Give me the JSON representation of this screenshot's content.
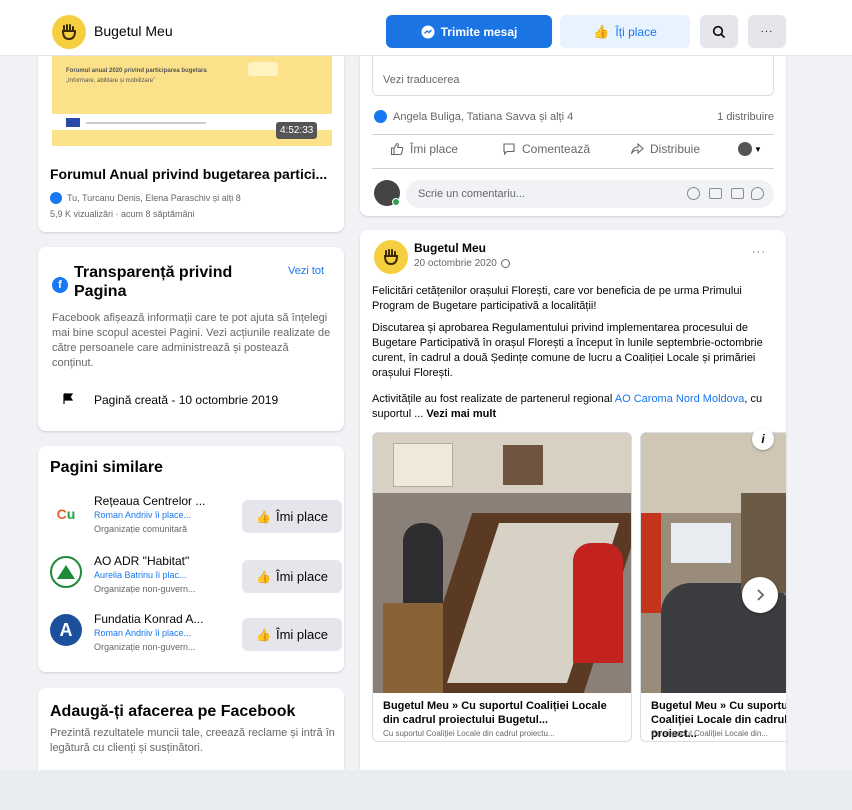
{
  "topbar": {
    "page_name": "Bugetul Meu",
    "send_message_label": "Trimite mesaj",
    "like_label": "Îți place",
    "more_label": "···"
  },
  "video_card": {
    "thumbnail_title_line1": "Forumul anual 2020 privind participarea bugetara",
    "thumbnail_title_line2": "„Informare, abilitare și mobilizare”",
    "duration": "4:52:33",
    "title": "Forumul Anual privind bugetarea partici...",
    "tagged": "Tu, Turcanu Denis, Elena Paraschiv și alți 8",
    "meta": "5,9 K vizualizări · acum 8 săptămâni"
  },
  "transparency": {
    "title": "Transparență privind Pagina",
    "see_all": "Vezi tot",
    "description": "Facebook afișează informații care te pot ajuta să înțelegi mai bine scopul acestei Pagini. Vezi acțiunile realizate de către persoanele care administrează și postează conținut.",
    "created": "Pagină creată - 10 octombrie 2019"
  },
  "similar_pages": {
    "title": "Pagini similare",
    "like_label": "Îmi place",
    "items": [
      {
        "name": "Rețeaua Centrelor ...",
        "friends": "Roman Andriiv îi place...",
        "category": "Organizație comunitară"
      },
      {
        "name": "AO ADR \"Habitat\"",
        "friends": "Aurelia Batrinu îi plac...",
        "category": "Organizație non-guvern..."
      },
      {
        "name": "Fundatia Konrad A...",
        "friends": "Roman Andriiv îi place...",
        "category": "Organizație non-guvern..."
      }
    ]
  },
  "add_business": {
    "title": "Adaugă-ți afacerea pe Facebook",
    "description": "Prezintă rezultatele muncii tale, creează reclame și intră în legătură cu clienți și susținători."
  },
  "prev_post": {
    "see_translation": "Vezi traducerea",
    "reactors": "Angela Buliga, Tatiana Savva și alți 4",
    "shares": "1 distribuire",
    "like": "Îmi place",
    "comment": "Comentează",
    "share": "Distribuie",
    "comment_placeholder": "Scrie un comentariu..."
  },
  "post": {
    "author": "Bugetul Meu",
    "date": "20 octombrie 2020",
    "paragraph1": "Felicitări cetățenilor orașului Florești, care vor beneficia de pe urma Primului Program de Bugetare participativă a localității!",
    "paragraph2": "Discutarea și aprobarea Regulamentului privind implementarea procesului de Bugetare Participativă în orașul Florești a început în lunile septembrie-octombrie curent, în cadrul a două Ședințe comune de lucru a Coaliției Locale și primăriei orașului Florești.",
    "paragraph3_start": "Activitățile au fost realizate de partenerul regional ",
    "paragraph3_link": "AO Caroma Nord Moldova",
    "paragraph3_end": ", cu suportul ... ",
    "see_more": "Vezi mai mult",
    "carousel": [
      {
        "title": "Bugetul Meu » Cu suportul Coaliției Locale din cadrul proiectului Bugetul...",
        "subtitle": "Cu suportul Coaliției Locale din cadrul proiectu..."
      },
      {
        "title": "Bugetul Meu » Cu suportul Coaliției Locale din cadrul proiect...",
        "subtitle": "Cu suportul Coaliției Locale din..."
      }
    ]
  },
  "colors": {
    "accent": "#1877f2",
    "logo_yellow": "#f6cf40"
  }
}
